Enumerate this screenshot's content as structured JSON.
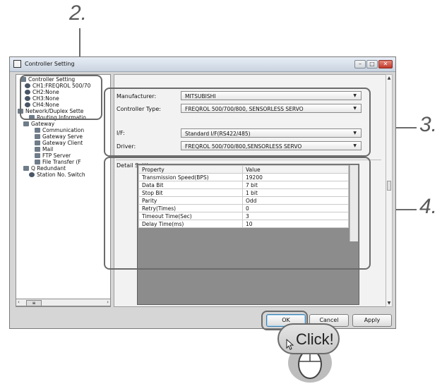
{
  "callouts": {
    "two": "2.",
    "three": "3.",
    "four": "4."
  },
  "window": {
    "title": "Controller Setting",
    "min": "–",
    "max": "□",
    "close": "✕"
  },
  "tree": {
    "root": "Controller Setting",
    "items": [
      "CH1:FREQROL 500/70",
      "CH2:None",
      "CH3:None",
      "CH4:None",
      "Network/Duplex Sette",
      "Routing Informatio",
      "Gateway",
      "Communication",
      "Gateway Serve",
      "Gateway Client",
      "Mail",
      "FTP Server",
      "File Transfer (F",
      "Q Redundant",
      "Station No. Switch"
    ]
  },
  "form": {
    "manufacturer_label": "Manufacturer:",
    "manufacturer_value": "MITSUBISHI",
    "controller_type_label": "Controller Type:",
    "controller_type_value": "FREQROL 500/700/800, SENSORLESS SERVO",
    "if_label": "I/F:",
    "if_value": "Standard I/F(RS422/485)",
    "driver_label": "Driver:",
    "driver_value": "FREQROL 500/700/800,SENSORLESS SERVO"
  },
  "detail": {
    "group_label": "Detail Setting",
    "headers": [
      "Property",
      "Value"
    ],
    "rows": [
      [
        "Transmission Speed(BPS)",
        "19200"
      ],
      [
        "Data Bit",
        "7 bit"
      ],
      [
        "Stop Bit",
        "1 bit"
      ],
      [
        "Parity",
        "Odd"
      ],
      [
        "Retry(Times)",
        "0"
      ],
      [
        "Timeout Time(Sec)",
        "3"
      ],
      [
        "Delay Time(ms)",
        "10"
      ]
    ]
  },
  "buttons": {
    "ok": "OK",
    "cancel": "Cancel",
    "apply": "Apply"
  },
  "bubble": {
    "text": "Click!"
  },
  "colors": {
    "callout": "#6b6b6b",
    "dialog": "#d6d6d6",
    "table_bg": "#8c8c8c"
  }
}
